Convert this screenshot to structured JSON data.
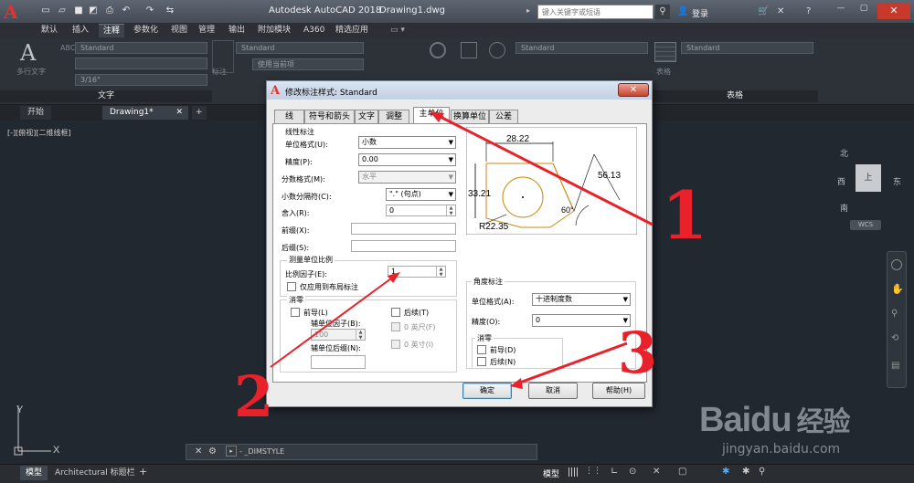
{
  "titlebar": {
    "logo_letter": "A",
    "app_title": "Autodesk AutoCAD 2018",
    "doc_title": "Drawing1.dwg",
    "search_placeholder": "键入关键字或短语",
    "signin": "登录"
  },
  "ribbon_tabs": [
    "默认",
    "插入",
    "注释",
    "参数化",
    "视图",
    "管理",
    "输出",
    "附加模块",
    "A360",
    "精选应用"
  ],
  "ribbon": {
    "text_panel_title": "文字",
    "table_panel_title": "表格",
    "mtext_label": "多行文字",
    "text_style": "Standard",
    "text_height": "3/16\"",
    "dim_style": "Standard",
    "layer_label": "使用当前项",
    "dim_label": "标注",
    "mleader_style": "Standard",
    "table_style": "Standard",
    "table_label": "表格"
  },
  "file_tabs": [
    "开始",
    "Drawing1*"
  ],
  "viewport_label": "[-][俯视][二维线框]",
  "viewcube": {
    "north": "北",
    "south": "南",
    "east": "东",
    "west": "西",
    "top": "上",
    "wcs": "WCS"
  },
  "command_line": "- _DIMSTYLE",
  "layout_tabs": [
    "模型",
    "Architectural 标题栏"
  ],
  "status": {
    "model": "模型"
  },
  "dialog": {
    "title": "修改标注样式: Standard",
    "tabs": [
      "线",
      "符号和箭头",
      "文字",
      "调整",
      "主单位",
      "换算单位",
      "公差"
    ],
    "active_tab": "主单位",
    "linear_section": "线性标注",
    "unit_format_label": "单位格式(U):",
    "unit_format_value": "小数",
    "precision_label": "精度(P):",
    "precision_value": "0.00",
    "fraction_label": "分数格式(M):",
    "fraction_value": "水平",
    "decimal_sep_label": "小数分隔符(C):",
    "decimal_sep_value": "\".\" (句点)",
    "round_label": "舍入(R):",
    "round_value": "0",
    "prefix_label": "前缀(X):",
    "suffix_label": "后缀(S):",
    "scale_section": "测量单位比例",
    "scale_factor_label": "比例因子(E):",
    "scale_factor_value": "1",
    "layout_only_label": "仅应用到布局标注",
    "zero_section": "消零",
    "leading_label": "前导(L)",
    "trailing_label": "后续(T)",
    "sub_unit_factor_label": "辅单位因子(B):",
    "sub_unit_factor_value": "100",
    "ft_label": "0 英尺(F)",
    "in_label": "0 英寸(I)",
    "sub_unit_suffix_label": "辅单位后缀(N):",
    "angular_section": "角度标注",
    "ang_format_label": "单位格式(A):",
    "ang_format_value": "十进制度数",
    "ang_precision_label": "精度(O):",
    "ang_precision_value": "0",
    "ang_zero_section": "消零",
    "ang_leading_label": "前导(D)",
    "ang_trailing_label": "后续(N)",
    "ok": "确定",
    "cancel": "取消",
    "help": "帮助(H)",
    "preview": {
      "dim_top": "28.22",
      "dim_left": "33.21",
      "dim_right": "56.13",
      "angle": "60°",
      "radius": "R22.35"
    }
  },
  "annotations": [
    "1",
    "2",
    "3"
  ],
  "watermark": {
    "brand": "Baidu",
    "cn": "经验",
    "url": "jingyan.baidu.com"
  }
}
